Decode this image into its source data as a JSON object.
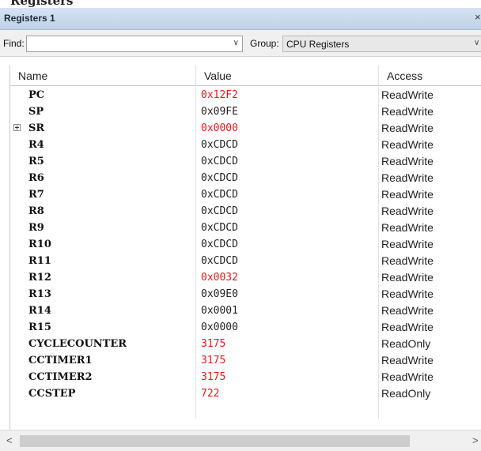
{
  "outer": {
    "ghost_title": "Registers"
  },
  "window": {
    "title": "Registers 1",
    "close_glyph": "×"
  },
  "toolbar": {
    "find_label": "Find:",
    "find_value": "",
    "group_label": "Group:",
    "group_value": "CPU Registers",
    "dropdown_glyph": "∨"
  },
  "columns": {
    "name": "Name",
    "value": "Value",
    "access": "Access"
  },
  "rows": [
    {
      "name": "PC",
      "value": "0x12F2",
      "access": "ReadWrite",
      "changed": true,
      "expandable": false
    },
    {
      "name": "SP",
      "value": "0x09FE",
      "access": "ReadWrite",
      "changed": false,
      "expandable": false
    },
    {
      "name": "SR",
      "value": "0x0000",
      "access": "ReadWrite",
      "changed": true,
      "expandable": true
    },
    {
      "name": "R4",
      "value": "0xCDCD",
      "access": "ReadWrite",
      "changed": false,
      "expandable": false
    },
    {
      "name": "R5",
      "value": "0xCDCD",
      "access": "ReadWrite",
      "changed": false,
      "expandable": false
    },
    {
      "name": "R6",
      "value": "0xCDCD",
      "access": "ReadWrite",
      "changed": false,
      "expandable": false
    },
    {
      "name": "R7",
      "value": "0xCDCD",
      "access": "ReadWrite",
      "changed": false,
      "expandable": false
    },
    {
      "name": "R8",
      "value": "0xCDCD",
      "access": "ReadWrite",
      "changed": false,
      "expandable": false
    },
    {
      "name": "R9",
      "value": "0xCDCD",
      "access": "ReadWrite",
      "changed": false,
      "expandable": false
    },
    {
      "name": "R10",
      "value": "0xCDCD",
      "access": "ReadWrite",
      "changed": false,
      "expandable": false
    },
    {
      "name": "R11",
      "value": "0xCDCD",
      "access": "ReadWrite",
      "changed": false,
      "expandable": false
    },
    {
      "name": "R12",
      "value": "0x0032",
      "access": "ReadWrite",
      "changed": true,
      "expandable": false
    },
    {
      "name": "R13",
      "value": "0x09E0",
      "access": "ReadWrite",
      "changed": false,
      "expandable": false
    },
    {
      "name": "R14",
      "value": "0x0001",
      "access": "ReadWrite",
      "changed": false,
      "expandable": false
    },
    {
      "name": "R15",
      "value": "0x0000",
      "access": "ReadWrite",
      "changed": false,
      "expandable": false
    },
    {
      "name": "CYCLECOUNTER",
      "value": "3175",
      "access": "ReadOnly",
      "changed": true,
      "expandable": false
    },
    {
      "name": "CCTIMER1",
      "value": "3175",
      "access": "ReadWrite",
      "changed": true,
      "expandable": false
    },
    {
      "name": "CCTIMER2",
      "value": "3175",
      "access": "ReadWrite",
      "changed": true,
      "expandable": false
    },
    {
      "name": "CCSTEP",
      "value": "722",
      "access": "ReadOnly",
      "changed": true,
      "expandable": false
    }
  ],
  "scrollbar": {
    "left_glyph": "<",
    "right_glyph": ">"
  },
  "colors": {
    "changed_value": "#e01b1b",
    "titlebar": "#c9d9ec"
  }
}
